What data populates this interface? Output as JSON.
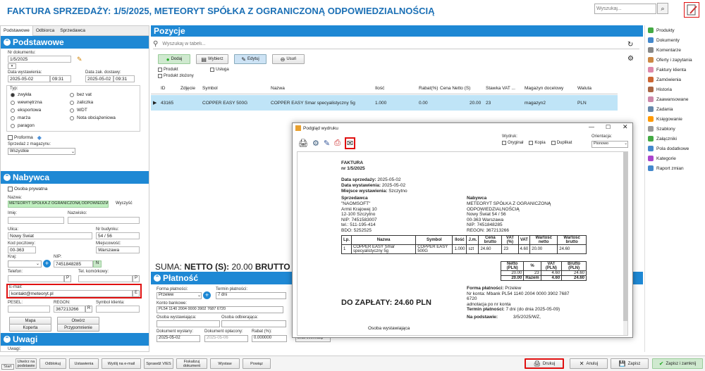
{
  "header": {
    "title": "FAKTURA SPRZEDAŻY: 1/5/2025, METEORYT SPÓŁKA Z OGRANICZONĄ ODPOWIEDZIALNOŚCIĄ",
    "search_placeholder": "Wyszukaj..."
  },
  "left": {
    "tabs": [
      "Podstawowe",
      "Odbiorca",
      "Sprzedawca"
    ],
    "podstawowe": {
      "title": "Podstawowe",
      "nr_label": "Nr dokumentu:",
      "nr_value": "1/5/2025",
      "data_wyst_label": "Data wystawienia:",
      "data_wyst": "2025-05-02",
      "data_wyst_time": "09:31",
      "data_dost_label": "Data zak. dostawy:",
      "data_dost": "2025-05-02",
      "data_dost_time": "09:31",
      "typ_label": "Typ:",
      "types": [
        "zwykła",
        "bez vat",
        "wewnętrzna",
        "zaliczka",
        "eksportowa",
        "WDT",
        "marża",
        "Nota obciążeniowa",
        "paragon"
      ],
      "proforma": "Proforma",
      "magazyn_label": "Sprzedaż z magazynu:",
      "magazyn_value": "Wszystkie"
    },
    "nabywca": {
      "title": "Nabywca",
      "osoba": "Osoba prywatna",
      "nazwa_label": "Nazwa:",
      "nazwa": "METEORYT SPÓŁKA Z OGRANICZONĄ ODPOWIEDZIALNOŚCIĄ",
      "wyczysc": "Wyczyść",
      "imie_label": "Imię:",
      "nazwisko_label": "Nazwisko:",
      "ulica_label": "Ulica:",
      "ulica": "Nowy Świat",
      "nr_budynku_label": "Nr budynku:",
      "nr_budynku": "54 / 56",
      "kod_label": "Kod pocztowy:",
      "kod": "00-363",
      "miejscowosc_label": "Miejscowość:",
      "miejscowosc": "Warszawa",
      "kraj_label": "Kraj:",
      "nip_label": "NIP:",
      "nip": "7451848285",
      "nip_badge": "N",
      "telefon_label": "Telefon:",
      "tel_kom_label": "Tel. komórkowy:",
      "p": "P",
      "email_label": "E-mail:",
      "email": "kontakt@meteoryt.pl",
      "e": "E",
      "pesel_label": "PESEL:",
      "regon_label": "REGON:",
      "regon": "367213266",
      "r": "R",
      "symbol_label": "Symbol klienta:",
      "mapa": "Mapa",
      "otworz": "Otwórz",
      "koperta": "Koperta",
      "przypomnienie": "Przypomnienie"
    },
    "uwagi": {
      "title": "Uwagi",
      "label": "Uwagi:"
    }
  },
  "pozycje": {
    "title": "Pozycje",
    "search_placeholder": "Wyszukaj w tabeli...",
    "buttons": {
      "dodaj": "Dodaj",
      "wybierz": "Wybierz",
      "edytuj": "Edytuj",
      "usun": "Usuń"
    },
    "checks": {
      "produkt": "Produkt",
      "usluga": "Usługa",
      "zlozony": "Produkt złożony"
    },
    "columns": [
      "ID",
      "Zdjęcie",
      "Symbol",
      "Nazwa",
      "Ilość",
      "Rabat(%)",
      "Cena Netto (S)",
      "Stawka VAT ...",
      "Magazyn docelowy",
      "Waluta"
    ],
    "row": {
      "id": "43165",
      "symbol": "COPPER EASY 500G",
      "nazwa": "COPPER EASY Smar specyalistyczny 5g",
      "ilosc": "1.000",
      "rabat": "0.00",
      "cena": "20.00",
      "vat": "23",
      "magazyn": "magazyn2",
      "waluta": "PLN"
    },
    "suma_prefix": "SUMA: ",
    "suma_netto_label": "NETTO (S): ",
    "suma_netto": "20.00",
    "suma_brutto_label": "BRUTTO (S"
  },
  "platnosc": {
    "title": "Płatność",
    "forma_label": "Forma płatności:",
    "forma": "Przelew",
    "termin_label": "Termin płatności:",
    "termin": "7 dni",
    "konto_label": "Konto bankowe:",
    "konto": "PL54 1140 2004 0000 3902 7687 6720",
    "osoba_wyst_label": "Osoba wystawiająca:",
    "osoba_odb_label": "Osoba odbierająca:",
    "dok_wyslany_label": "Dokument wysłany:",
    "dok_wyslany": "2025-05-02",
    "dok_oplacony_label": "Dokument opłacony:",
    "dok_oplacony": "2025-05-06",
    "rabat_label": "Rabat (%):",
    "rabat": "0.000000",
    "brak_info": "Brak informacji"
  },
  "right": {
    "items": [
      "Produkty",
      "Dokumenty",
      "Komentarze",
      "Oferty i zapytania",
      "Faktury klienta",
      "Zamówienia",
      "Historia",
      "Zaawansowane",
      "Zadania",
      "Księgowanie",
      "Szablony",
      "Załączniki",
      "Pola dodatkowe",
      "Kategorie",
      "Raport zmian"
    ]
  },
  "bottom": {
    "buttons": [
      "Utwórz na podstawie",
      "Odblokuj",
      "Ustawienia",
      "Wyślij na e-mail",
      "Sprawdź VIES",
      "Fiskalizuj dokument",
      "Wystaw",
      "Powiąz"
    ],
    "start": "Start",
    "drukuj": "Drukuj",
    "anuluj": "Anuluj",
    "zapisz": "Zapisz",
    "zapisz_zamknij": "Zapisz i zamknij"
  },
  "preview": {
    "window_title": "Podgląd wydruku",
    "wydruk_label": "Wydruk:",
    "oryginal": "Oryginał",
    "kopia": "Kopia",
    "duplikat": "Duplikat",
    "orientacja_label": "Orientacja:",
    "orientacja": "Pionowo",
    "doc_title": "FAKTURA",
    "doc_nr": "nr 1/5/2025",
    "data_sprzedazy_label": "Data sprzedaży:",
    "data_sprzedazy": "2025-05-02",
    "data_wystawienia_label": "Data wystawienia:",
    "data_wystawienia": "2025-05-02",
    "miejsce_label": "Miejsce wystawienia:",
    "miejsce": "Szczytno",
    "sprzedawca_label": "Sprzedawca",
    "sprzedawca": [
      "\"NAOMSOFT\"",
      "Armii Krajowej 10",
      "12-100 Szczytno",
      "NIP: 7451583007",
      "tel.: 511-195-414",
      "BDO: 5252525"
    ],
    "nabywca_label": "Nabywca",
    "nabywca": [
      "METEORYT SPÓŁKA Z OGRANICZONĄ",
      "ODPOWIEDZIALNOŚCIĄ",
      "Nowy Świat 54 / 56",
      "00-363 Warszawa",
      "NIP: 7451848285",
      "REGON: 367213266"
    ],
    "t_headers": [
      "Lp.",
      "Nazwa",
      "Symbol",
      "Ilość",
      "J.m.",
      "Cena brutto",
      "VAT (%)",
      "VAT",
      "Wartość netto",
      "Wartość brutto"
    ],
    "t_row": [
      "1",
      "COPPER EASY Smar specyalistyczny 5g",
      "COPPER EASY 500G",
      "1.000",
      "szt",
      "24.60",
      "23",
      "4.60",
      "20.00",
      "24.60"
    ],
    "s_headers": [
      "Netto (PLN)",
      "%",
      "VAT (PLN)",
      "Brutto (PLN)"
    ],
    "s_row": [
      "20.00",
      "23",
      "4.60",
      "24.60"
    ],
    "s_total": [
      "20.00",
      "Razem",
      "4.60",
      "24.60"
    ],
    "do_zaplaty": "DO ZAPŁATY: 24.60 PLN",
    "forma_label": "Forma płatności:",
    "forma": "Przelew",
    "konto_line1": "Nr konta: Mbank PL54 1140 2004 0000 3902 7687",
    "konto_line2": "6720",
    "adnotacja": "adnotacja po nr konta",
    "termin_label": "Termin płatności:",
    "termin": "7 dni (do dnia 2025-05-09)",
    "podstawa_label": "Na podstawie:",
    "podstawa": "3/5/2025/WZ,",
    "osoba": "Osoba wystawiająca"
  },
  "colors": {
    "accent": "#1e88d4",
    "header_text": "#1a6fb5",
    "highlight": "#e01010",
    "row_selected": "#bfe4f7"
  }
}
